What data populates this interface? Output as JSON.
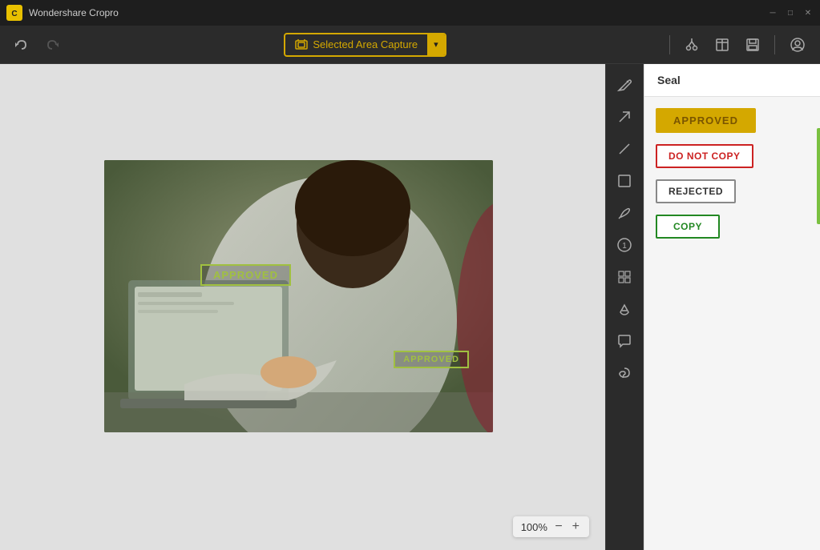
{
  "app": {
    "title": "Wondershare Cropro",
    "icon": "C"
  },
  "titlebar": {
    "minimize_label": "─",
    "restore_label": "□",
    "close_label": "✕"
  },
  "toolbar": {
    "undo_label": "↩",
    "redo_label": "↪",
    "capture_label": "Selected Area Capture",
    "dropdown_label": "▾",
    "cut_label": "✂",
    "window_label": "□",
    "save_label": "💾",
    "account_label": "👤"
  },
  "zoom": {
    "level": "100%",
    "minus_label": "−",
    "plus_label": "+"
  },
  "vertical_tools": [
    {
      "name": "edit-tool",
      "icon": "✏",
      "tooltip": "Edit"
    },
    {
      "name": "arrow-tool",
      "icon": "↗",
      "tooltip": "Arrow"
    },
    {
      "name": "line-tool",
      "icon": "/",
      "tooltip": "Line"
    },
    {
      "name": "shape-tool",
      "icon": "⬚",
      "tooltip": "Shape"
    },
    {
      "name": "pen-tool",
      "icon": "✒",
      "tooltip": "Pen"
    },
    {
      "name": "number-tool",
      "icon": "①",
      "tooltip": "Number"
    },
    {
      "name": "mosaic-tool",
      "icon": "▦",
      "tooltip": "Mosaic"
    },
    {
      "name": "paint-tool",
      "icon": "🖌",
      "tooltip": "Paint"
    },
    {
      "name": "speech-tool",
      "icon": "💬",
      "tooltip": "Speech Bubble"
    },
    {
      "name": "lasso-tool",
      "icon": "◌",
      "tooltip": "Lasso"
    }
  ],
  "panel": {
    "title": "Seal",
    "items": [
      {
        "name": "seal-approved",
        "text": "APPROVED",
        "type": "approved"
      },
      {
        "name": "seal-do-not-copy",
        "text": "DO NOT COPY",
        "type": "donotcopy"
      },
      {
        "name": "seal-rejected",
        "text": "REJECTED",
        "type": "rejected"
      },
      {
        "name": "seal-copy",
        "text": "COPY",
        "type": "copy"
      }
    ]
  },
  "canvas": {
    "stamp1_text": "APPROVED",
    "stamp2_text": "APPROVED"
  }
}
